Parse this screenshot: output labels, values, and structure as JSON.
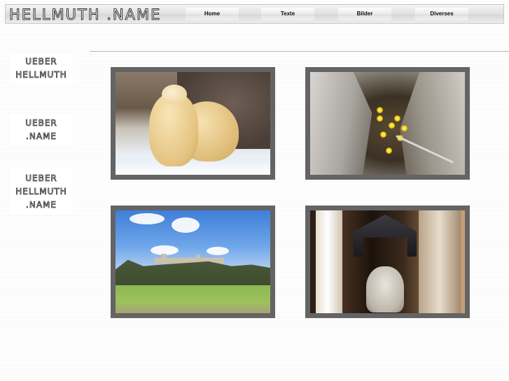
{
  "header": {
    "logo_text": "HELLMUTH .NAME",
    "nav": [
      {
        "label": "Home"
      },
      {
        "label": "Texte"
      },
      {
        "label": "Bilder"
      },
      {
        "label": "Diverses"
      }
    ]
  },
  "sidebar": {
    "items": [
      {
        "lines": [
          "UEBER",
          "HELLMUTH"
        ]
      },
      {
        "lines": [
          "UEBER",
          ".NAME"
        ]
      },
      {
        "lines": [
          "UEBER",
          "HELLMUTH",
          ".NAME"
        ]
      }
    ]
  },
  "gallery": {
    "images": [
      {
        "subject": "polar-bears"
      },
      {
        "subject": "cave-lights"
      },
      {
        "subject": "castle-landscape"
      },
      {
        "subject": "church-statue"
      }
    ]
  },
  "colors": {
    "frame": "#646464",
    "divider": "#b8b8b8"
  }
}
